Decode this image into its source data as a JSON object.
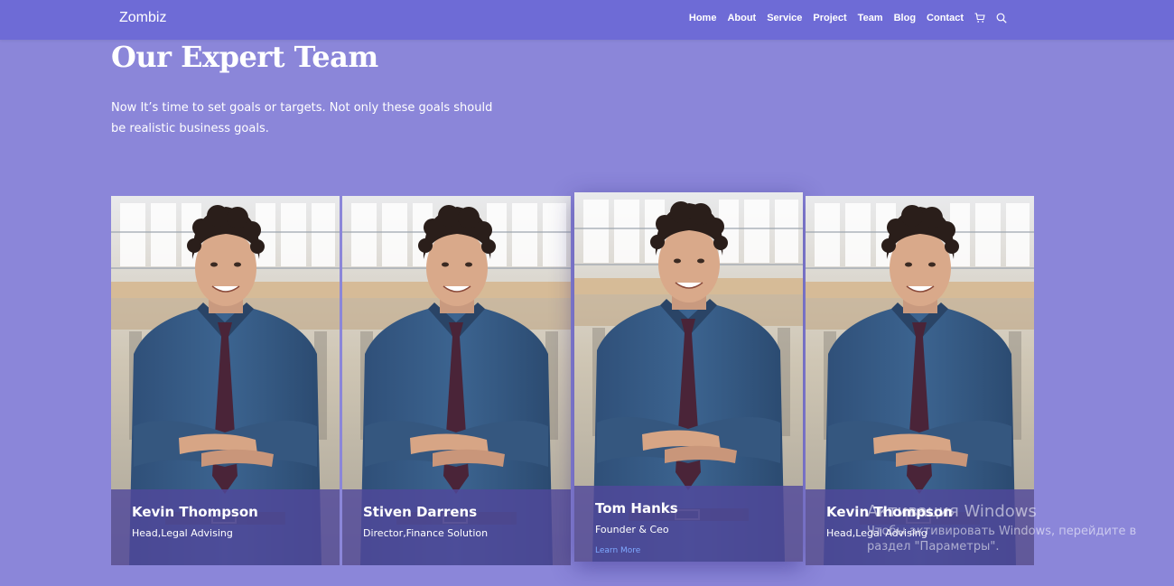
{
  "brand": "Zombiz",
  "nav": {
    "items": [
      "Home",
      "About",
      "Service",
      "Project",
      "Team",
      "Blog",
      "Contact"
    ],
    "icons": [
      "cart-icon",
      "search-icon"
    ]
  },
  "hero": {
    "title": "Our Expert Team",
    "subtitle": "Now It’s time to set goals or targets. Not only these goals should be realistic business goals."
  },
  "team": [
    {
      "name": "Kevin Thompson",
      "role": "Head,Legal Advising"
    },
    {
      "name": "Stiven Darrens",
      "role": "Director,Finance Solution"
    },
    {
      "name": "Tom Hanks",
      "role": "Founder & Ceo",
      "link": "Learn More"
    },
    {
      "name": "Kevin Thompson",
      "role": "Head,Legal Advising"
    }
  ],
  "watermark": {
    "line1": "Активация Windows",
    "line2": "Чтобы активировать Windows, перейдите в",
    "line3": "раздел \"Параметры\"."
  },
  "colors": {
    "background": "#8b86d9",
    "navbar": "#6e6bd6",
    "overlay": "#50489b",
    "link": "#7fa9ff"
  }
}
